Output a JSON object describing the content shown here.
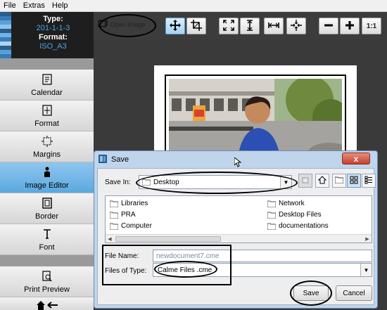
{
  "menu": [
    "File",
    "Extras",
    "Help"
  ],
  "info": {
    "type_label": "Type:",
    "type_value": "201-1-1-3",
    "format_label": "Format:",
    "format_value": "ISO_A3"
  },
  "sidebar": {
    "items": [
      {
        "label": "Calendar",
        "icon": "calendar-icon"
      },
      {
        "label": "Format",
        "icon": "format-icon"
      },
      {
        "label": "Margins",
        "icon": "margins-icon"
      },
      {
        "label": "Image Editor",
        "icon": "image-editor-icon",
        "active": true
      },
      {
        "label": "Border",
        "icon": "border-icon"
      },
      {
        "label": "Font",
        "icon": "font-icon"
      },
      {
        "label": "Print Preview",
        "icon": "print-preview-icon"
      }
    ]
  },
  "toolbar": {
    "open_image": "Open Image",
    "zoom_one": "1:1"
  },
  "dialog": {
    "title": "Save",
    "close": "x",
    "save_in_label": "Save In:",
    "save_in_value": "Desktop",
    "files": [
      {
        "name": "Libraries"
      },
      {
        "name": "Network"
      },
      {
        "name": "PRA"
      },
      {
        "name": "Desktop Files"
      },
      {
        "name": "Computer"
      },
      {
        "name": "documentations"
      }
    ],
    "file_name_label": "File Name:",
    "file_name_value": "newdocument7.cme",
    "files_of_type_label": "Files of Type:",
    "files_of_type_value": "Calme Files .cme",
    "save_button": "Save",
    "cancel_button": "Cancel"
  },
  "colors": {
    "accent": "#4aa3e6",
    "active_sidebar": "#6fb4e6"
  }
}
